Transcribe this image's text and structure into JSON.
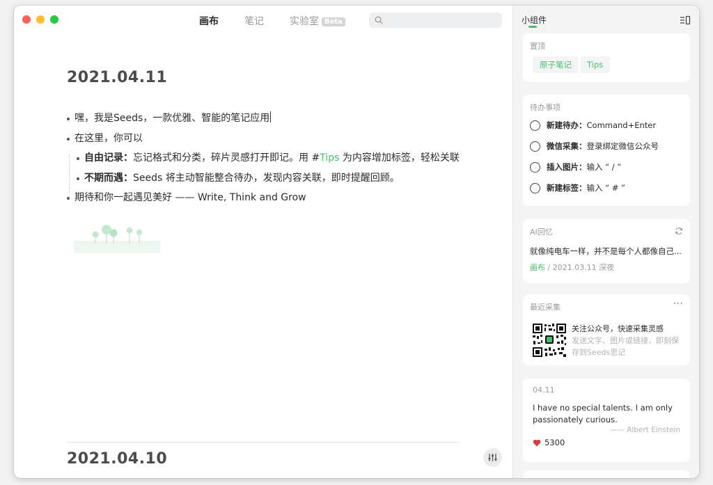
{
  "tabs": {
    "canvas": "画布",
    "notes": "笔记",
    "lab": "实验室",
    "lab_badge": "Beta"
  },
  "search": {
    "placeholder": ""
  },
  "entry1": {
    "date": "2021.04.11",
    "lines": [
      "嘿，我是Seeds，一款优雅、智能的笔记应用",
      "在这里，你可以"
    ],
    "item1_bold": "自由记录：",
    "item1_text": "忘记格式和分类，碎片灵感打开即记。用 #",
    "item1_tag": "Tips",
    "item1_text2": " 为内容增加标签，轻松关联",
    "item2_bold": "不期而遇：",
    "item2_text": "Seeds 将主动智能整合待办，发现内容关联，即时提醒回顾。",
    "line_last": "期待和你一起遇见美好 —— Write, Think and Grow"
  },
  "entry2": {
    "date": "2021.04.10"
  },
  "sidebar": {
    "title": "小组件",
    "pinned": {
      "title": "置顶",
      "chips": [
        "原子笔记",
        "Tips"
      ]
    },
    "todos": {
      "title": "待办事项",
      "items": [
        {
          "label": "新建待办：",
          "value": "Command+Enter"
        },
        {
          "label": "微信采集：",
          "value": "登录绑定微信公众号"
        },
        {
          "label": "插入图片：",
          "value": "输入 “ / ”"
        },
        {
          "label": "新建标签：",
          "value": "输入 “ # ”"
        }
      ]
    },
    "ai": {
      "title": "AI回忆",
      "text": "就像纯电车一样，并不是每个人都像自己...",
      "source": "画布",
      "meta": " / 2021.03.11 深夜"
    },
    "collect": {
      "title": "最近采集",
      "more": "···",
      "line1": "关注公众号，快速采集灵感",
      "line2": "发送文字、图片或链接，即刻保",
      "line3": "存到Seeds思记"
    },
    "quote": {
      "date": "04.11",
      "text": "I have no special talents. I am only passionately curious.",
      "author": "—— Albert Einstein",
      "likes": "5300"
    }
  },
  "colors": {
    "accent": "#44c168",
    "heart": "#e0383e"
  }
}
